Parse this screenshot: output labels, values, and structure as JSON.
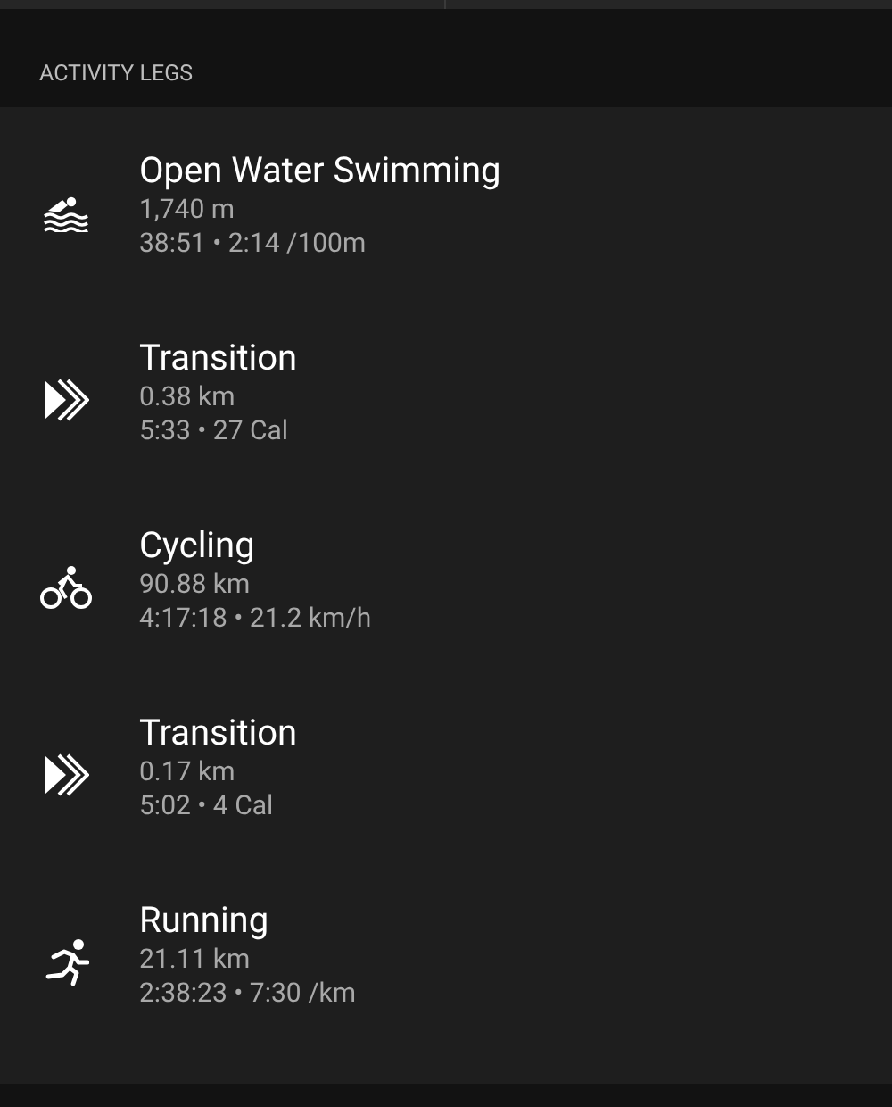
{
  "section": {
    "title": "ACTIVITY LEGS"
  },
  "legs": [
    {
      "kind": "swim",
      "title": "Open Water Swimming",
      "distance": "1,740 m",
      "details": "38:51 • 2:14 /100m"
    },
    {
      "kind": "transition",
      "title": "Transition",
      "distance": "0.38 km",
      "details": "5:33 • 27 Cal"
    },
    {
      "kind": "bike",
      "title": "Cycling",
      "distance": "90.88 km",
      "details": "4:17:18 • 21.2 km/h"
    },
    {
      "kind": "transition",
      "title": "Transition",
      "distance": "0.17 km",
      "details": "5:02 • 4 Cal"
    },
    {
      "kind": "run",
      "title": "Running",
      "distance": "21.11 km",
      "details": "2:38:23 • 7:30 /km"
    }
  ]
}
